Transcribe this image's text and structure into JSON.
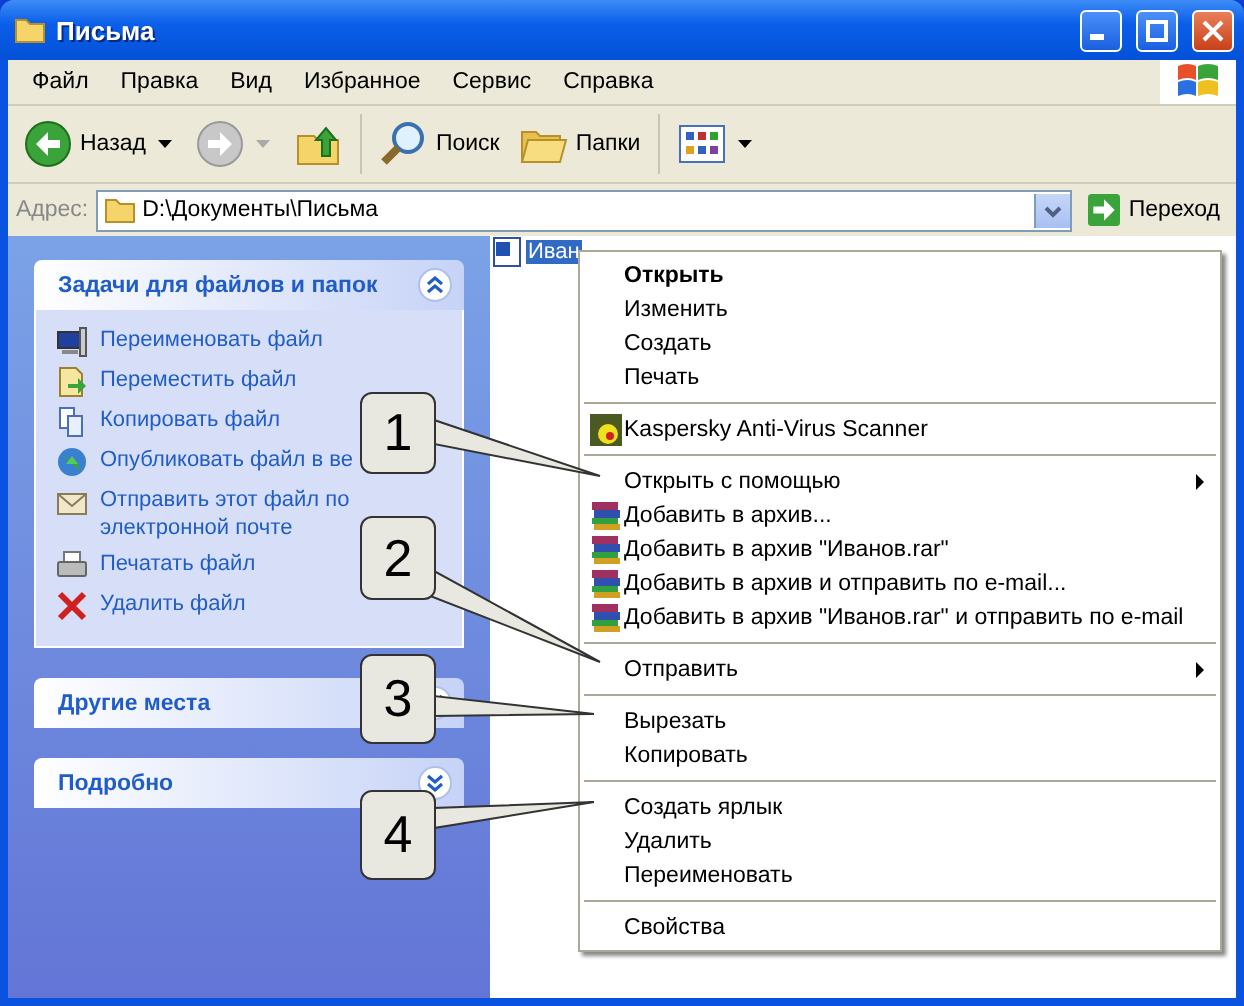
{
  "window": {
    "title": "Письма"
  },
  "menu_bar": [
    "Файл",
    "Правка",
    "Вид",
    "Избранное",
    "Сервис",
    "Справка"
  ],
  "toolbar": [
    {
      "kind": "back",
      "label": "Назад"
    },
    {
      "kind": "forward"
    },
    {
      "kind": "up"
    },
    {
      "kind": "search",
      "label": "Поиск"
    },
    {
      "kind": "folders",
      "label": "Папки"
    },
    {
      "kind": "views"
    }
  ],
  "address_bar": {
    "label": "Адрес:",
    "value": "D:\\Документы\\Письма",
    "go": "Переход"
  },
  "task_pane": [
    {
      "title": "Задачи для файлов и папок",
      "expanded": true,
      "items": [
        {
          "kind": "rename",
          "label": "Переименовать файл"
        },
        {
          "kind": "move",
          "label": "Переместить файл"
        },
        {
          "kind": "copy",
          "label": "Копировать файл"
        },
        {
          "kind": "publish",
          "label": "Опубликовать файл в ве"
        },
        {
          "kind": "email",
          "label": "Отправить этот файл по электронной почте"
        },
        {
          "kind": "print",
          "label": "Печатать файл"
        },
        {
          "kind": "delete",
          "label": "Удалить файл"
        }
      ]
    },
    {
      "title": "Другие места",
      "expanded": false
    },
    {
      "title": "Подробно",
      "expanded": false
    }
  ],
  "files": [
    {
      "name": "Иван",
      "selected": true
    }
  ],
  "context_menu": [
    {
      "kind": "item",
      "label": "Открыть",
      "bold": true
    },
    {
      "kind": "item",
      "label": "Изменить"
    },
    {
      "kind": "item",
      "label": "Создать"
    },
    {
      "kind": "item",
      "label": "Печать"
    },
    {
      "kind": "separator"
    },
    {
      "kind": "antivirus",
      "label": "Kaspersky Anti-Virus Scanner"
    },
    {
      "kind": "separator"
    },
    {
      "kind": "submenu",
      "label": "Открыть с помощью"
    },
    {
      "kind": "archive",
      "label": "Добавить в архив..."
    },
    {
      "kind": "archive",
      "label": "Добавить в архив \"Иванов.rar\""
    },
    {
      "kind": "archive",
      "label": "Добавить в архив и отправить по e-mail..."
    },
    {
      "kind": "archive",
      "label": "Добавить в архив \"Иванов.rar\" и отправить по e-mail"
    },
    {
      "kind": "separator"
    },
    {
      "kind": "submenu",
      "label": "Отправить"
    },
    {
      "kind": "separator"
    },
    {
      "kind": "item",
      "label": "Вырезать"
    },
    {
      "kind": "item",
      "label": "Копировать"
    },
    {
      "kind": "separator"
    },
    {
      "kind": "item",
      "label": "Создать ярлык"
    },
    {
      "kind": "item",
      "label": "Удалить"
    },
    {
      "kind": "item",
      "label": "Переименовать"
    },
    {
      "kind": "separator"
    },
    {
      "kind": "item",
      "label": "Свойства"
    }
  ],
  "callouts": [
    "1",
    "2",
    "3",
    "4"
  ]
}
